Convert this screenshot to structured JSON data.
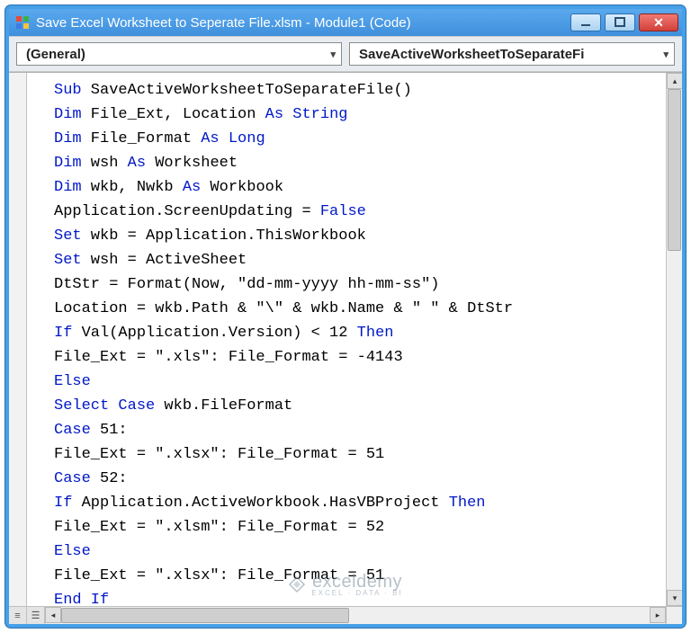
{
  "window": {
    "title": "Save Excel Worksheet to Seperate File.xlsm - Module1 (Code)"
  },
  "toolbar": {
    "left_combo": "(General)",
    "right_combo": "SaveActiveWorksheetToSeparateFi"
  },
  "code": {
    "lines": [
      [
        [
          "kw",
          "Sub"
        ],
        [
          "",
          " SaveActiveWorksheetToSeparateFile()"
        ]
      ],
      [
        [
          "kw",
          "Dim"
        ],
        [
          "",
          " File_Ext, Location "
        ],
        [
          "kw",
          "As String"
        ]
      ],
      [
        [
          "kw",
          "Dim"
        ],
        [
          "",
          " File_Format "
        ],
        [
          "kw",
          "As Long"
        ]
      ],
      [
        [
          "kw",
          "Dim"
        ],
        [
          "",
          " wsh "
        ],
        [
          "kw",
          "As"
        ],
        [
          "",
          " Worksheet"
        ]
      ],
      [
        [
          "kw",
          "Dim"
        ],
        [
          "",
          " wkb, Nwkb "
        ],
        [
          "kw",
          "As"
        ],
        [
          "",
          " Workbook"
        ]
      ],
      [
        [
          "",
          "Application.ScreenUpdating = "
        ],
        [
          "kw",
          "False"
        ]
      ],
      [
        [
          "kw",
          "Set"
        ],
        [
          "",
          " wkb = Application.ThisWorkbook"
        ]
      ],
      [
        [
          "kw",
          "Set"
        ],
        [
          "",
          " wsh = ActiveSheet"
        ]
      ],
      [
        [
          "",
          "DtStr = Format(Now, \"dd-mm-yyyy hh-mm-ss\")"
        ]
      ],
      [
        [
          "",
          "Location = wkb.Path & \"\\\" & wkb.Name & \" \" & DtStr"
        ]
      ],
      [
        [
          "kw",
          "If"
        ],
        [
          "",
          " Val(Application.Version) < 12 "
        ],
        [
          "kw",
          "Then"
        ]
      ],
      [
        [
          "",
          "File_Ext = \".xls\": File_Format = -4143"
        ]
      ],
      [
        [
          "kw",
          "Else"
        ]
      ],
      [
        [
          "kw",
          "Select Case"
        ],
        [
          "",
          " wkb.FileFormat"
        ]
      ],
      [
        [
          "kw",
          "Case"
        ],
        [
          "",
          " 51:"
        ]
      ],
      [
        [
          "",
          "File_Ext = \".xlsx\": File_Format = 51"
        ]
      ],
      [
        [
          "kw",
          "Case"
        ],
        [
          "",
          " 52:"
        ]
      ],
      [
        [
          "kw",
          "If"
        ],
        [
          "",
          " Application.ActiveWorkbook.HasVBProject "
        ],
        [
          "kw",
          "Then"
        ]
      ],
      [
        [
          "",
          "File_Ext = \".xlsm\": File_Format = 52"
        ]
      ],
      [
        [
          "kw",
          "Else"
        ]
      ],
      [
        [
          "",
          "File_Ext = \".xlsx\": File_Format = 51"
        ]
      ],
      [
        [
          "kw",
          "End If"
        ]
      ]
    ]
  },
  "watermark": {
    "brand": "exceldemy",
    "tagline": "EXCEL · DATA · BI"
  }
}
